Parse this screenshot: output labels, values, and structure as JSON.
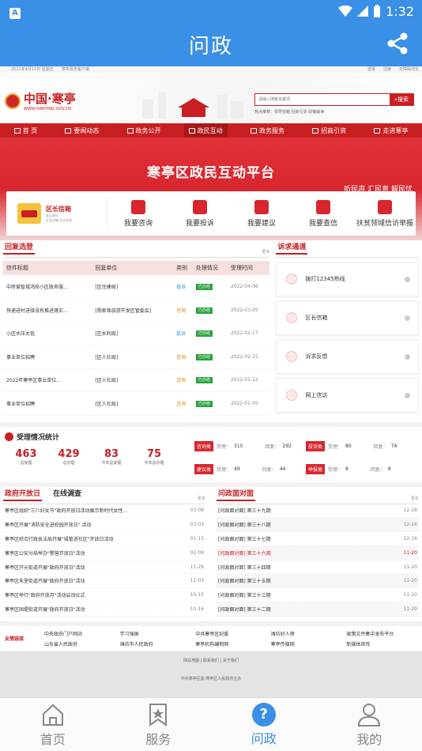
{
  "status": {
    "time": "1:32",
    "app_icon": "A"
  },
  "titlebar": {
    "title": "问政"
  },
  "site": {
    "topstrip_left": "2022年4月15日 星期五",
    "topstrip_left2": "寒亭政务客户端",
    "topstrip_right": [
      "登录",
      "注册",
      "无障碍浏览"
    ],
    "logo_name": "中国·寒亭",
    "logo_url": "WWW.HANTING.GOV.CN",
    "search_placeholder": "请输入搜索关键词",
    "search_button": "搜索",
    "hotwords": "热点推荐：",
    "hotword_items": "领导信箱  招商引资  政策解读"
  },
  "nav": [
    "首 页",
    "要闻动态",
    "政务公开",
    "政民互动",
    "政务服务",
    "招商引资",
    "走进寒亭"
  ],
  "banner": {
    "title": "寒亭区政民互动平台",
    "slogan": "听民声 汇民意 解民忧",
    "mailbox_title": "区长信箱",
    "mailbox_sub1": "意见建议",
    "mailbox_sub2": "区长信箱 区长热线",
    "items": [
      "我要咨询",
      "我要投诉",
      "我要建议",
      "我要查信",
      "扶贫领域信访举报"
    ]
  },
  "reply": {
    "title": "回复选登",
    "more": "更多",
    "headers": [
      "信件标题",
      "回复单位",
      "类别",
      "处理情况",
      "受理时间"
    ],
    "rows": [
      {
        "title": "中房爱智城鸿府小区政务服...",
        "unit": "[区住建局]",
        "type": "投诉",
        "status": "已办结",
        "date": "2022-04-06",
        "color": "#2b8de0"
      },
      {
        "title": "快递进村进驿没有推进落实...",
        "unit": "[杨家埠旅游开发区管委会]",
        "type": "咨询",
        "status": "已办结",
        "date": "2022-03-05",
        "color": "#e6801a"
      },
      {
        "title": "小区水压太低",
        "unit": "[区水利局]",
        "type": "投诉",
        "status": "已办结",
        "date": "2022-02-17",
        "color": "#2b8de0"
      },
      {
        "title": "事业单位招聘",
        "unit": "[区人社局]",
        "type": "咨询",
        "status": "已办结",
        "date": "2022-02-15",
        "color": "#e6801a"
      },
      {
        "title": "2022年寒亭区事业单位...",
        "unit": "[区人社局]",
        "type": "咨询",
        "status": "已办结",
        "date": "2022-01-12",
        "color": "#e6801a"
      },
      {
        "title": "事业单位招聘",
        "unit": "[区人社局]",
        "type": "咨询",
        "status": "已办结",
        "date": "2022-01-05",
        "color": "#e6801a"
      }
    ]
  },
  "channels": {
    "title": "诉求通道",
    "items": [
      "拨打12345热线",
      "区长信箱",
      "诉求反馈",
      "网上信访"
    ]
  },
  "stats": {
    "title": "受理情况统计",
    "nums": [
      {
        "v": "463",
        "l": "总受理"
      },
      {
        "v": "429",
        "l": "总办理"
      },
      {
        "v": "83",
        "l": "今年总受理"
      },
      {
        "v": "75",
        "l": "今年总办理"
      }
    ],
    "kv": [
      {
        "k": "咨询类",
        "a": "受理：",
        "av": "315",
        "b": "回复：",
        "bv": "292"
      },
      {
        "k": "投诉类",
        "a": "受理：",
        "av": "80",
        "b": "回复：",
        "bv": "74"
      },
      {
        "k": "建议类",
        "a": "受理：",
        "av": "49",
        "b": "回复：",
        "bv": "44"
      },
      {
        "k": "举报类",
        "a": "受理：",
        "av": "8",
        "b": "回复：",
        "bv": "8"
      }
    ]
  },
  "open_day": {
    "tab1": "政府开放日",
    "tab2": "在线调查",
    "more": "更多",
    "items": [
      {
        "t": "寒亭区组织\"三八妇女节\"政府开放日活动展示新时代女性...",
        "d": "03-08"
      },
      {
        "t": "寒亭区开展\"消防安全进校园开放日\" 活动",
        "d": "03-03"
      },
      {
        "t": "寒亭区综合行政执法局开展\"城管进社区\"开放日活动",
        "d": "01-13"
      },
      {
        "t": "寒亭区公安分局举办\"警营开放日\"活动",
        "d": "01-09"
      },
      {
        "t": "寒亭区开元街道开展\"政府开放日\"活动",
        "d": "11-29"
      },
      {
        "t": "寒亭区朱里街道开展\"政府开放日\"活动",
        "d": "11-03"
      },
      {
        "t": "寒亭区举行\"政府开放月\"活动启动仪式",
        "d": "10-15"
      },
      {
        "t": "寒亭区固堤街道开展\"政府开放日\"活动",
        "d": "10-14"
      }
    ]
  },
  "face": {
    "title": "问政面对面",
    "more": "更多",
    "items": [
      {
        "t": "[问政面对面] 第三十九期",
        "d": "12-28"
      },
      {
        "t": "[问政面对面] 第三十八期",
        "d": "12-16"
      },
      {
        "t": "[问政面对面] 第三十七期",
        "d": "12-16"
      },
      {
        "t": "[问政面对面] 第三十六期",
        "d": "11-20"
      },
      {
        "t": "[问政面对面] 第三十四期",
        "d": "11-20"
      },
      {
        "t": "[问政面对面] 第三十五期",
        "d": "11-20"
      },
      {
        "t": "[问政面对面] 第三十三期",
        "d": "11-20"
      },
      {
        "t": "[问政面对面] 第三十二期",
        "d": "11-20"
      }
    ]
  },
  "links": {
    "label": "友情链接",
    "items": [
      "中央政府门户网站",
      "学习强国",
      "中共寒亭区纪委",
      "潍坊好人榜",
      "政策文件集中发布平台",
      "山东省人民政府",
      "潍坊市人民政府",
      "寒亭机构编制网",
      "寒亭传媒网",
      "新媒体矩阵"
    ]
  },
  "footer": {
    "line1": "网站地图 | 联系我们 | 关于我们",
    "line2": "中共寒亭区委 寒亭区人民政府主办"
  },
  "tabbar": [
    {
      "label": "首页",
      "active": false
    },
    {
      "label": "服务",
      "active": false
    },
    {
      "label": "问政",
      "active": true
    },
    {
      "label": "我的",
      "active": false
    }
  ],
  "colors": {
    "accent": "#3a8fe6",
    "brand_red": "#c81f23",
    "done_green": "#2aa33a"
  }
}
